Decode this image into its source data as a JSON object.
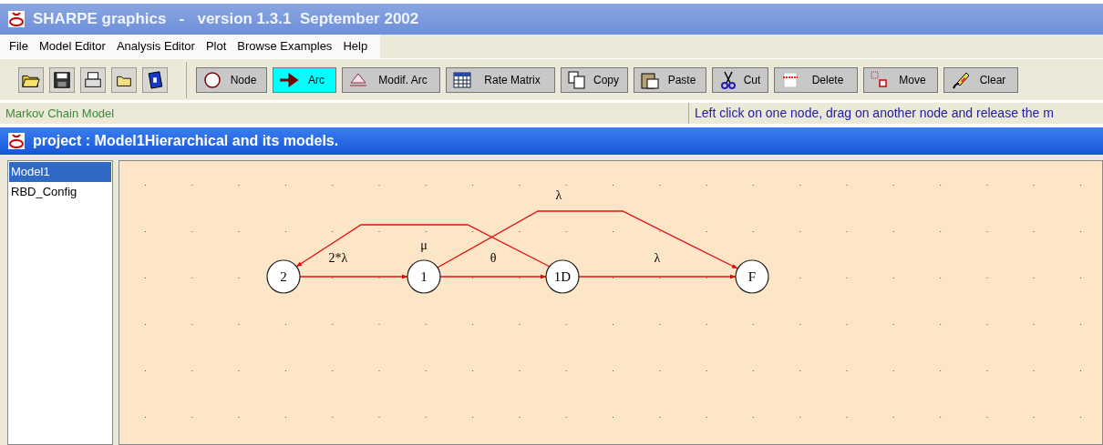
{
  "window": {
    "title": "SHARPE graphics   -   version 1.3.1  September 2002"
  },
  "menu": [
    "File",
    "Model Editor",
    "Analysis Editor",
    "Plot",
    "Browse Examples",
    "Help"
  ],
  "tools": [
    {
      "label": "Node",
      "selected": false
    },
    {
      "label": "Arc",
      "selected": true
    },
    {
      "label": "Modif. Arc",
      "selected": false
    },
    {
      "label": "Rate Matrix",
      "selected": false
    },
    {
      "label": "Copy",
      "selected": false
    },
    {
      "label": "Paste",
      "selected": false
    },
    {
      "label": "Cut",
      "selected": false
    },
    {
      "label": "Delete",
      "selected": false
    },
    {
      "label": "Move",
      "selected": false
    },
    {
      "label": "Clear",
      "selected": false
    }
  ],
  "status_bar": {
    "model_type": "Markov Chain Model",
    "hint": "Left click on one node, drag on another node and release the m"
  },
  "project_window": {
    "title": "project : Model1Hierarchical and its models.",
    "models": [
      {
        "label": "Model1",
        "selected": true
      },
      {
        "label": "RBD_Config",
        "selected": false
      }
    ],
    "diagram": {
      "nodes": [
        {
          "label": "2"
        },
        {
          "label": "1"
        },
        {
          "label": "1D"
        },
        {
          "label": "F"
        }
      ],
      "arcs": [
        {
          "label": "2*λ"
        },
        {
          "label": "θ"
        },
        {
          "label": "λ"
        },
        {
          "label": "μ"
        },
        {
          "label": "λ"
        }
      ]
    }
  }
}
